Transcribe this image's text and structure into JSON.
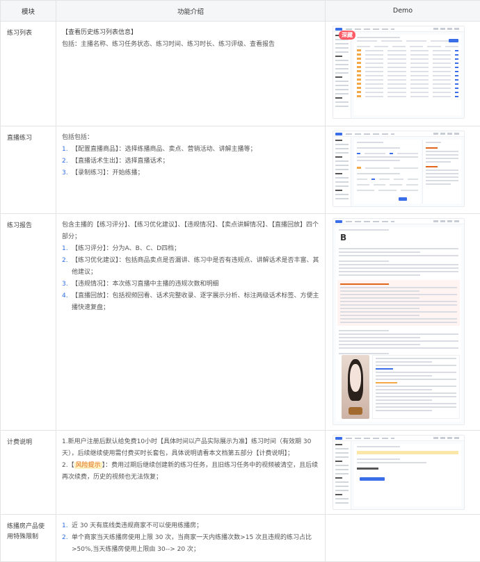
{
  "headers": {
    "module": "模块",
    "intro": "功能介绍",
    "demo": "Demo"
  },
  "rows": [
    {
      "module": "练习列表",
      "title": "【查看历史练习列表信息】",
      "body": "包括：主播名称、练习任务状态、练习时间、练习时长、练习评级、查看报告",
      "demo_tag": "深藏"
    },
    {
      "module": "直播练习",
      "lead": "包括包括：",
      "items": [
        {
          "n": "1.",
          "text": "【配置直播商品】：选择练播商品、卖点、营销活动、讲解主播等；"
        },
        {
          "n": "2.",
          "text": "【直播话术生出】：选择直播话术；"
        },
        {
          "n": "3.",
          "text": "【录制练习】：开始练播；"
        }
      ]
    },
    {
      "module": "练习报告",
      "lead": "包含主播的【练习评分】、【练习优化建议】、【违规情况】、【卖点讲解情况】、【直播回放】四个部分；",
      "items": [
        {
          "n": "1.",
          "text": "【练习评分】：分为A、B、C、D四档；"
        },
        {
          "n": "2.",
          "text": "【练习优化建议】：包括商品卖点是否漏讲、练习中是否有违规点、讲解话术是否丰富、其他建议；"
        },
        {
          "n": "3.",
          "text": "【违规情况】：本次练习直播中主播的违规次数和明细"
        },
        {
          "n": "4.",
          "text": "【直播回放】：包括视频回看、话术完整收录、逐字展示分析、标注两级话术标签、方便主播快速复盘；"
        }
      ],
      "demo_grade": "B"
    },
    {
      "module": "计费说明",
      "p1": "1.新用户注册后默认给免费10小时【具体时间以产品实际展示为准】练习时间（有效期 30 天），后续继续使用需付费买时长套包，具体说明请看本文档第五部分【计费说明】；",
      "p2_prefix": "2.【",
      "p2_risk": "风险提示",
      "p2_rest": "】：费用过期后继续创建新的练习任务，且旧练习任务中的视频被清空，且后续再次续费，历史的视频也无法恢复；"
    },
    {
      "module": "练播房产品使用特殊限制",
      "items": [
        {
          "n": "1.",
          "text": "近 30 天有底线类违规商家不可以使用练播房；"
        },
        {
          "n": "2.",
          "text": "单个商家当天练播房使用上限 30 次，当商家一天内练播次数>15 次且违规的练习占比>50%,当天练播房使用上限由 30--> 20 次；"
        }
      ]
    }
  ],
  "colors": {
    "accent": "#2f6de1",
    "risk_bg": "#fff3c4",
    "risk_text": "#e0651b",
    "tag": "#ff5b66"
  }
}
